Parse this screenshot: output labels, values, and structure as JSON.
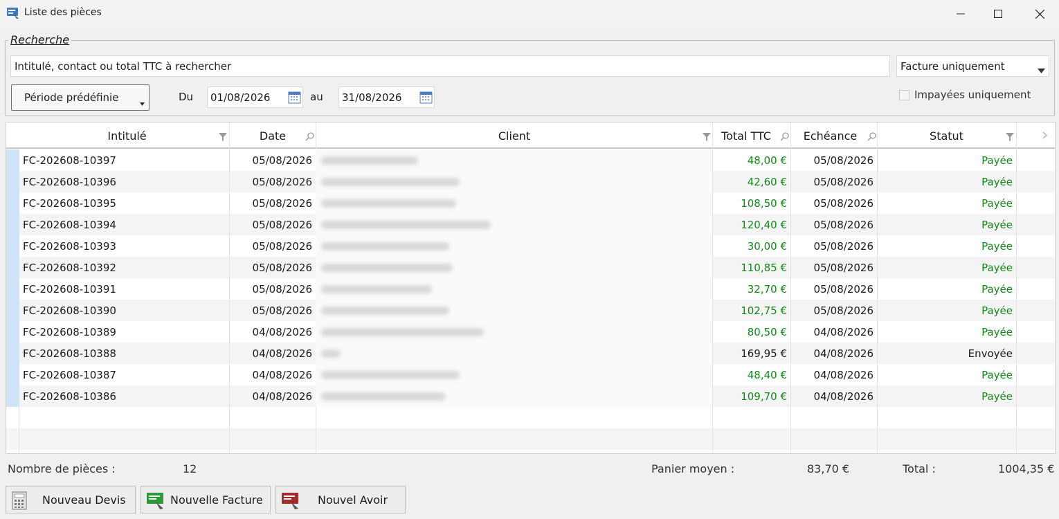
{
  "window": {
    "title": "Liste des pièces"
  },
  "search": {
    "legend": "Recherche",
    "placeholder": "Intitulé, contact ou total TTC à rechercher",
    "type_selected": "Facture uniquement",
    "period_label": "Période prédéfinie",
    "from_label": "Du",
    "from_date": "01/08/2026",
    "to_label": "au",
    "to_date": "31/08/2026",
    "unpaid_label": "Impayées uniquement",
    "unpaid_checked": false
  },
  "grid": {
    "columns": [
      "Intitulé",
      "Date",
      "Client",
      "Total TTC",
      "Echéance",
      "Statut"
    ],
    "rows": [
      {
        "ref": "FC-202608-10397",
        "date": "05/08/2026",
        "total": "48,00 €",
        "due": "05/08/2026",
        "status": "Payée",
        "paid": true
      },
      {
        "ref": "FC-202608-10396",
        "date": "05/08/2026",
        "total": "42,60 €",
        "due": "05/08/2026",
        "status": "Payée",
        "paid": true
      },
      {
        "ref": "FC-202608-10395",
        "date": "05/08/2026",
        "total": "108,50 €",
        "due": "05/08/2026",
        "status": "Payée",
        "paid": true
      },
      {
        "ref": "FC-202608-10394",
        "date": "05/08/2026",
        "total": "120,40 €",
        "due": "05/08/2026",
        "status": "Payée",
        "paid": true
      },
      {
        "ref": "FC-202608-10393",
        "date": "05/08/2026",
        "total": "30,00 €",
        "due": "05/08/2026",
        "status": "Payée",
        "paid": true
      },
      {
        "ref": "FC-202608-10392",
        "date": "05/08/2026",
        "total": "110,85 €",
        "due": "05/08/2026",
        "status": "Payée",
        "paid": true
      },
      {
        "ref": "FC-202608-10391",
        "date": "05/08/2026",
        "total": "32,70 €",
        "due": "05/08/2026",
        "status": "Payée",
        "paid": true
      },
      {
        "ref": "FC-202608-10390",
        "date": "05/08/2026",
        "total": "102,75 €",
        "due": "05/08/2026",
        "status": "Payée",
        "paid": true
      },
      {
        "ref": "FC-202608-10389",
        "date": "04/08/2026",
        "total": "80,50 €",
        "due": "04/08/2026",
        "status": "Payée",
        "paid": true
      },
      {
        "ref": "FC-202608-10388",
        "date": "04/08/2026",
        "total": "169,95 €",
        "due": "04/08/2026",
        "status": "Envoyée",
        "paid": false
      },
      {
        "ref": "FC-202608-10387",
        "date": "04/08/2026",
        "total": "48,40 €",
        "due": "04/08/2026",
        "status": "Payée",
        "paid": true
      },
      {
        "ref": "FC-202608-10386",
        "date": "04/08/2026",
        "total": "109,70 €",
        "due": "04/08/2026",
        "status": "Payée",
        "paid": true
      }
    ]
  },
  "summary": {
    "count_label": "Nombre de pièces :",
    "count_value": "12",
    "avg_label": "Panier moyen :",
    "avg_value": "83,70 €",
    "total_label": "Total :",
    "total_value": "1004,35 €"
  },
  "actions": {
    "new_quote": "Nouveau Devis",
    "new_invoice": "Nouvelle Facture",
    "new_credit": "Nouvel Avoir"
  },
  "colors": {
    "paid_green": "#0f8a14",
    "selection_blue": "#cfe3f7"
  }
}
